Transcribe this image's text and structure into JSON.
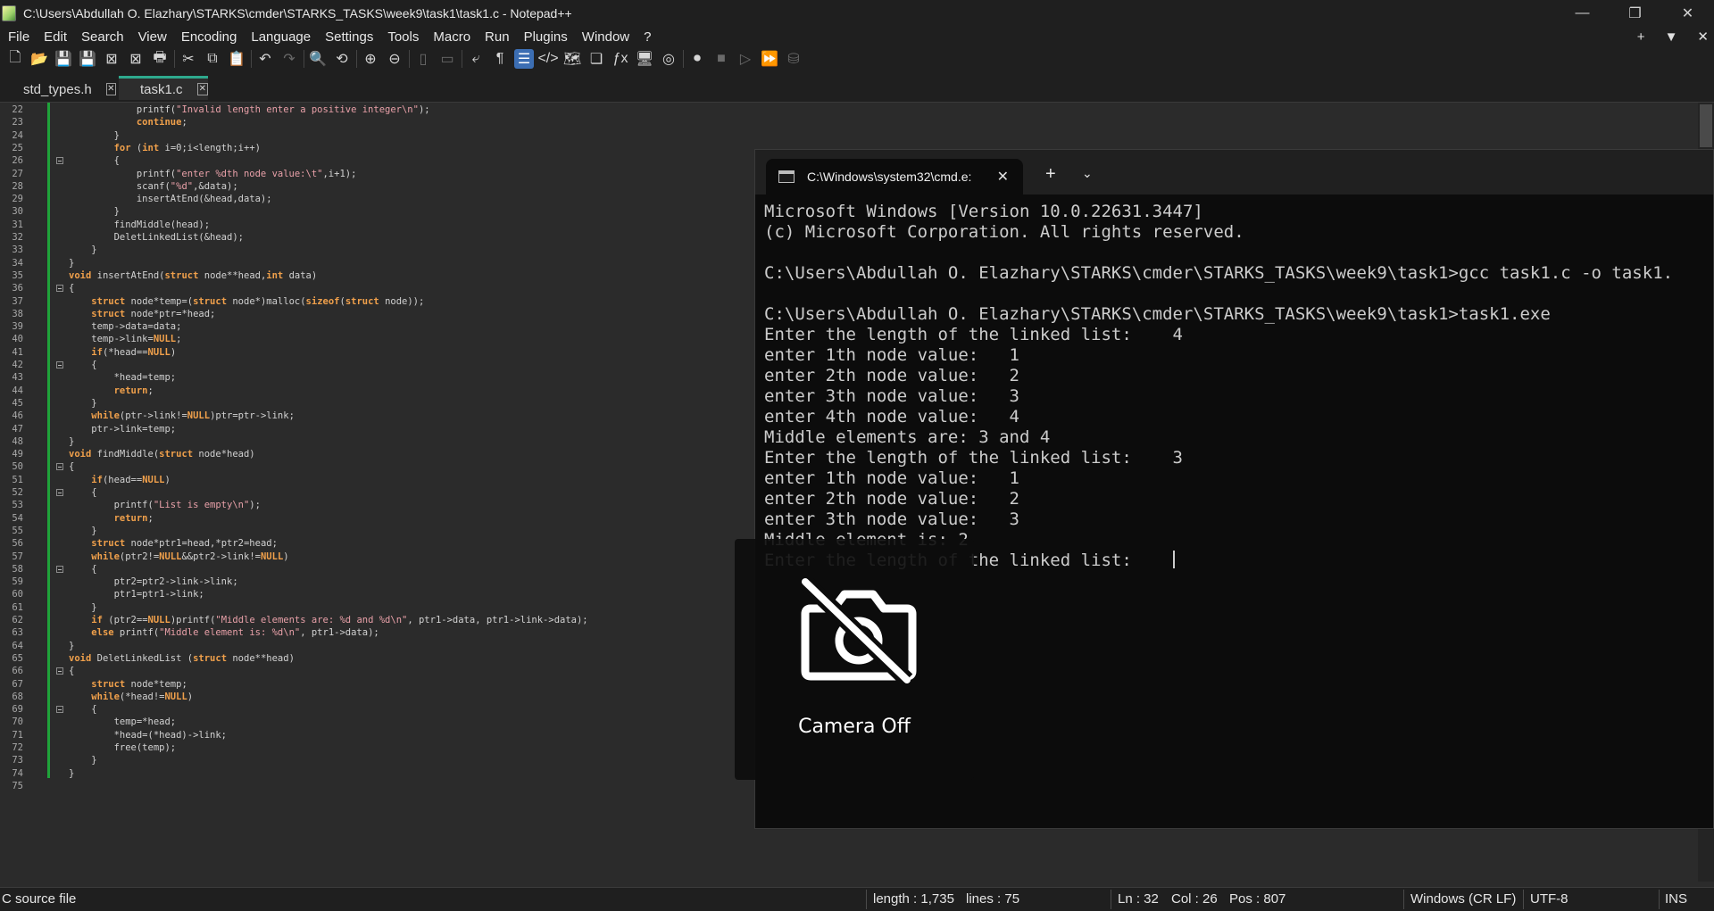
{
  "window": {
    "title": "C:\\Users\\Abdullah O. Elazhary\\STARKS\\cmder\\STARKS_TASKS\\week9\\task1\\task1.c - Notepad++",
    "controls": [
      "—",
      "❐",
      "✕"
    ]
  },
  "menu": {
    "items": [
      "File",
      "Edit",
      "Search",
      "View",
      "Encoding",
      "Language",
      "Settings",
      "Tools",
      "Macro",
      "Run",
      "Plugins",
      "Window",
      "?"
    ],
    "right": [
      "+",
      "▼",
      "✕"
    ]
  },
  "toolbar": {
    "icons": [
      {
        "name": "new-file-icon",
        "glyph": "🗋"
      },
      {
        "name": "open-file-icon",
        "glyph": "📂"
      },
      {
        "name": "save-icon",
        "glyph": "💾",
        "dim": true
      },
      {
        "name": "save-all-icon",
        "glyph": "💾",
        "dim": true
      },
      {
        "name": "close-icon",
        "glyph": "⊠"
      },
      {
        "name": "close-all-icon",
        "glyph": "⊠"
      },
      {
        "name": "print-icon",
        "glyph": "🖶"
      },
      {
        "name": "cut-icon",
        "glyph": "✂"
      },
      {
        "name": "copy-icon",
        "glyph": "⧉"
      },
      {
        "name": "paste-icon",
        "glyph": "📋"
      },
      {
        "name": "undo-icon",
        "glyph": "↶"
      },
      {
        "name": "redo-icon",
        "glyph": "↷",
        "dim": true
      },
      {
        "name": "find-icon",
        "glyph": "🔍"
      },
      {
        "name": "replace-icon",
        "glyph": "⟲"
      },
      {
        "name": "zoom-in-icon",
        "glyph": "⊕"
      },
      {
        "name": "zoom-out-icon",
        "glyph": "⊖"
      },
      {
        "name": "sync-vertical-icon",
        "glyph": "▯",
        "dim": true
      },
      {
        "name": "sync-horizontal-icon",
        "glyph": "▭",
        "dim": true
      },
      {
        "name": "word-wrap-icon",
        "glyph": "⤶"
      },
      {
        "name": "show-all-chars-icon",
        "glyph": "¶"
      },
      {
        "name": "indent-guide-icon",
        "glyph": "☰",
        "active": true
      },
      {
        "name": "xml-tag-icon",
        "glyph": "</>"
      },
      {
        "name": "document-map-icon",
        "glyph": "🗺"
      },
      {
        "name": "doc-list-icon",
        "glyph": "❏"
      },
      {
        "name": "function-list-icon",
        "glyph": "ƒx"
      },
      {
        "name": "folder-workspace-icon",
        "glyph": "🖥"
      },
      {
        "name": "monitoring-icon",
        "glyph": "◎"
      },
      {
        "name": "record-macro-icon",
        "glyph": "⏺"
      },
      {
        "name": "stop-macro-icon",
        "glyph": "■",
        "dim": true
      },
      {
        "name": "play-macro-icon",
        "glyph": "▷",
        "dim": true
      },
      {
        "name": "run-macro-multiple-icon",
        "glyph": "⏩"
      },
      {
        "name": "save-macro-icon",
        "glyph": "⛁",
        "dim": true
      }
    ]
  },
  "tabs": [
    {
      "label": "std_types.h",
      "active": false
    },
    {
      "label": "task1.c",
      "active": true
    }
  ],
  "editor": {
    "current_line": 32,
    "lines": [
      {
        "n": "22",
        "fold": false,
        "code": [
          [
            "            ",
            ""
          ],
          [
            "printf(",
            "ty"
          ],
          [
            "\"Invalid length enter a positive integer\\n\"",
            "str"
          ],
          [
            ");",
            ""
          ]
        ]
      },
      {
        "n": "23",
        "fold": false,
        "code": [
          [
            "            ",
            ""
          ],
          [
            "continue",
            "kw"
          ],
          [
            ";",
            ""
          ]
        ]
      },
      {
        "n": "24",
        "fold": false,
        "code": [
          [
            "        }",
            ""
          ]
        ]
      },
      {
        "n": "25",
        "fold": false,
        "code": [
          [
            "        ",
            ""
          ],
          [
            "for",
            "kw"
          ],
          [
            " (",
            ""
          ],
          [
            "int",
            "kw"
          ],
          [
            " i=0;i<length;i++)",
            ""
          ]
        ]
      },
      {
        "n": "26",
        "fold": true,
        "code": [
          [
            "        {",
            ""
          ]
        ]
      },
      {
        "n": "27",
        "fold": false,
        "code": [
          [
            "            printf(",
            ""
          ],
          [
            "\"enter %dth node value:\\t\"",
            "str"
          ],
          [
            ",i+1);",
            ""
          ]
        ]
      },
      {
        "n": "28",
        "fold": false,
        "code": [
          [
            "            scanf(",
            ""
          ],
          [
            "\"%d\"",
            "str"
          ],
          [
            ",&data);",
            ""
          ]
        ]
      },
      {
        "n": "29",
        "fold": false,
        "code": [
          [
            "            insertAtEnd(&head,data);",
            ""
          ]
        ]
      },
      {
        "n": "30",
        "fold": false,
        "code": [
          [
            "        }",
            ""
          ]
        ]
      },
      {
        "n": "31",
        "fold": false,
        "code": [
          [
            "        findMiddle(head);",
            ""
          ]
        ]
      },
      {
        "n": "32",
        "fold": false,
        "code": [
          [
            "        DeletLinkedList(&head);",
            ""
          ]
        ]
      },
      {
        "n": "33",
        "fold": false,
        "code": [
          [
            "    }",
            ""
          ]
        ]
      },
      {
        "n": "34",
        "fold": false,
        "code": [
          [
            "}",
            ""
          ]
        ]
      },
      {
        "n": "35",
        "fold": false,
        "code": [
          [
            "void",
            "kw"
          ],
          [
            " insertAtEnd(",
            ""
          ],
          [
            "struct",
            "kw"
          ],
          [
            " node**head,",
            ""
          ],
          [
            "int",
            "kw"
          ],
          [
            " data)",
            ""
          ]
        ]
      },
      {
        "n": "36",
        "fold": true,
        "code": [
          [
            "{",
            ""
          ]
        ]
      },
      {
        "n": "37",
        "fold": false,
        "code": [
          [
            "    ",
            ""
          ],
          [
            "struct",
            "kw"
          ],
          [
            " node*temp=(",
            ""
          ],
          [
            "struct",
            "kw"
          ],
          [
            " node*)malloc(",
            ""
          ],
          [
            "sizeof",
            "kw"
          ],
          [
            "(",
            ""
          ],
          [
            "struct",
            "kw"
          ],
          [
            " node));",
            ""
          ]
        ]
      },
      {
        "n": "38",
        "fold": false,
        "code": [
          [
            "    ",
            ""
          ],
          [
            "struct",
            "kw"
          ],
          [
            " node*ptr=*head;",
            ""
          ]
        ]
      },
      {
        "n": "39",
        "fold": false,
        "code": [
          [
            "    temp->data=data;",
            ""
          ]
        ]
      },
      {
        "n": "40",
        "fold": false,
        "code": [
          [
            "    temp->link=",
            ""
          ],
          [
            "NULL",
            "kw"
          ],
          [
            ";",
            ""
          ]
        ]
      },
      {
        "n": "41",
        "fold": false,
        "code": [
          [
            "    ",
            ""
          ],
          [
            "if",
            "kw"
          ],
          [
            "(*head==",
            ""
          ],
          [
            "NULL",
            "kw"
          ],
          [
            ")",
            ""
          ]
        ]
      },
      {
        "n": "42",
        "fold": true,
        "code": [
          [
            "    {",
            ""
          ]
        ]
      },
      {
        "n": "43",
        "fold": false,
        "code": [
          [
            "        *head=temp;",
            ""
          ]
        ]
      },
      {
        "n": "44",
        "fold": false,
        "code": [
          [
            "        ",
            ""
          ],
          [
            "return",
            "kw"
          ],
          [
            ";",
            ""
          ]
        ]
      },
      {
        "n": "45",
        "fold": false,
        "code": [
          [
            "    }",
            ""
          ]
        ]
      },
      {
        "n": "46",
        "fold": false,
        "code": [
          [
            "    ",
            ""
          ],
          [
            "while",
            "kw"
          ],
          [
            "(ptr->link!=",
            ""
          ],
          [
            "NULL",
            "kw"
          ],
          [
            ")ptr=ptr->link;",
            ""
          ]
        ]
      },
      {
        "n": "47",
        "fold": false,
        "code": [
          [
            "    ptr->link=temp;",
            ""
          ]
        ]
      },
      {
        "n": "48",
        "fold": false,
        "code": [
          [
            "}",
            ""
          ]
        ]
      },
      {
        "n": "49",
        "fold": false,
        "code": [
          [
            "void",
            "kw"
          ],
          [
            " findMiddle(",
            ""
          ],
          [
            "struct",
            "kw"
          ],
          [
            " node*head)",
            ""
          ]
        ]
      },
      {
        "n": "50",
        "fold": true,
        "code": [
          [
            "{",
            ""
          ]
        ]
      },
      {
        "n": "51",
        "fold": false,
        "code": [
          [
            "    ",
            ""
          ],
          [
            "if",
            "kw"
          ],
          [
            "(head==",
            ""
          ],
          [
            "NULL",
            "kw"
          ],
          [
            ")",
            ""
          ]
        ]
      },
      {
        "n": "52",
        "fold": true,
        "code": [
          [
            "    {",
            ""
          ]
        ]
      },
      {
        "n": "53",
        "fold": false,
        "code": [
          [
            "        printf(",
            ""
          ],
          [
            "\"List is empty\\n\"",
            "str"
          ],
          [
            ");",
            ""
          ]
        ]
      },
      {
        "n": "54",
        "fold": false,
        "code": [
          [
            "        ",
            ""
          ],
          [
            "return",
            "kw"
          ],
          [
            ";",
            ""
          ]
        ]
      },
      {
        "n": "55",
        "fold": false,
        "code": [
          [
            "    }",
            ""
          ]
        ]
      },
      {
        "n": "56",
        "fold": false,
        "code": [
          [
            "    ",
            ""
          ],
          [
            "struct",
            "kw"
          ],
          [
            " node*ptr1=head,*ptr2=head;",
            ""
          ]
        ]
      },
      {
        "n": "57",
        "fold": false,
        "code": [
          [
            "    ",
            ""
          ],
          [
            "while",
            "kw"
          ],
          [
            "(ptr2!=",
            ""
          ],
          [
            "NULL",
            "kw"
          ],
          [
            "&&ptr2->link!=",
            ""
          ],
          [
            "NULL",
            "kw"
          ],
          [
            ")",
            ""
          ]
        ]
      },
      {
        "n": "58",
        "fold": true,
        "code": [
          [
            "    {",
            ""
          ]
        ]
      },
      {
        "n": "59",
        "fold": false,
        "code": [
          [
            "        ptr2=ptr2->link->link;",
            ""
          ]
        ]
      },
      {
        "n": "60",
        "fold": false,
        "code": [
          [
            "        ptr1=ptr1->link;",
            ""
          ]
        ]
      },
      {
        "n": "61",
        "fold": false,
        "code": [
          [
            "    }",
            ""
          ]
        ]
      },
      {
        "n": "62",
        "fold": false,
        "code": [
          [
            "    ",
            ""
          ],
          [
            "if",
            "kw"
          ],
          [
            " (ptr2==",
            ""
          ],
          [
            "NULL",
            "kw"
          ],
          [
            ")printf(",
            ""
          ],
          [
            "\"Middle elements are: %d and %d\\n\"",
            "str"
          ],
          [
            ", ptr1->data, ptr1->link->data);",
            ""
          ]
        ]
      },
      {
        "n": "63",
        "fold": false,
        "code": [
          [
            "    ",
            ""
          ],
          [
            "else",
            "kw"
          ],
          [
            " printf(",
            ""
          ],
          [
            "\"Middle element is: %d\\n\"",
            "str"
          ],
          [
            ", ptr1->data);",
            ""
          ]
        ]
      },
      {
        "n": "64",
        "fold": false,
        "code": [
          [
            "}",
            ""
          ]
        ]
      },
      {
        "n": "65",
        "fold": false,
        "code": [
          [
            "void",
            "kw"
          ],
          [
            " DeletLinkedList (",
            ""
          ],
          [
            "struct",
            "kw"
          ],
          [
            " node**head)",
            ""
          ]
        ]
      },
      {
        "n": "66",
        "fold": true,
        "code": [
          [
            "{",
            ""
          ]
        ]
      },
      {
        "n": "67",
        "fold": false,
        "code": [
          [
            "    ",
            ""
          ],
          [
            "struct",
            "kw"
          ],
          [
            " node*temp;",
            ""
          ]
        ]
      },
      {
        "n": "68",
        "fold": false,
        "code": [
          [
            "    ",
            ""
          ],
          [
            "while",
            "kw"
          ],
          [
            "(*head!=",
            ""
          ],
          [
            "NULL",
            "kw"
          ],
          [
            ")",
            ""
          ]
        ]
      },
      {
        "n": "69",
        "fold": true,
        "code": [
          [
            "    {",
            ""
          ]
        ]
      },
      {
        "n": "70",
        "fold": false,
        "code": [
          [
            "        temp=*head;",
            ""
          ]
        ]
      },
      {
        "n": "71",
        "fold": false,
        "code": [
          [
            "        *head=(*head)->link;",
            ""
          ]
        ]
      },
      {
        "n": "72",
        "fold": false,
        "code": [
          [
            "        free(temp);",
            ""
          ]
        ]
      },
      {
        "n": "73",
        "fold": false,
        "code": [
          [
            "    }",
            ""
          ]
        ]
      },
      {
        "n": "74",
        "fold": false,
        "code": [
          [
            "}",
            ""
          ]
        ]
      },
      {
        "n": "75",
        "fold": false,
        "code": [
          [
            "",
            ""
          ]
        ]
      }
    ]
  },
  "terminal": {
    "tab_title": "C:\\Windows\\system32\\cmd.e:",
    "tab_close": "✕",
    "new_tab": "+",
    "dropdown": "⌄",
    "lines": [
      "Microsoft Windows [Version 10.0.22631.3447]",
      "(c) Microsoft Corporation. All rights reserved.",
      "",
      "C:\\Users\\Abdullah O. Elazhary\\STARKS\\cmder\\STARKS_TASKS\\week9\\task1>gcc task1.c -o task1.",
      "",
      "C:\\Users\\Abdullah O. Elazhary\\STARKS\\cmder\\STARKS_TASKS\\week9\\task1>task1.exe",
      "Enter the length of the linked list:    4",
      "enter 1th node value:   1",
      "enter 2th node value:   2",
      "enter 3th node value:   3",
      "enter 4th node value:   4",
      "Middle elements are: 3 and 4",
      "Enter the length of the linked list:    3",
      "enter 1th node value:   1",
      "enter 2th node value:   2",
      "enter 3th node value:   3",
      "Middle element is: 2",
      "Enter the length of the linked list:    "
    ]
  },
  "camera": {
    "label": "Camera Off"
  },
  "statusbar": {
    "file_type": "C source file",
    "length": "length : 1,735",
    "lines": "lines : 75",
    "ln": "Ln : 32",
    "col": "Col : 26",
    "pos": "Pos : 807",
    "eol": "Windows (CR LF)",
    "encoding": "UTF-8",
    "mode": "INS"
  }
}
